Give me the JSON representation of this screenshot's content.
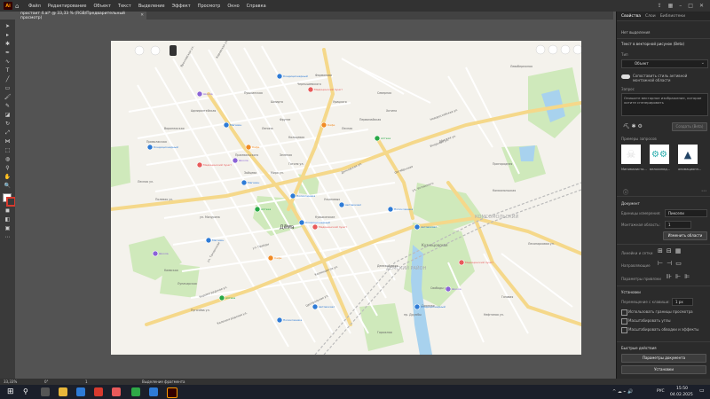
{
  "app": {
    "logo": "Ai"
  },
  "menu": [
    "Файл",
    "Редактирование",
    "Объект",
    "Текст",
    "Выделение",
    "Эффект",
    "Просмотр",
    "Окно",
    "Справка"
  ],
  "document_tab": {
    "title": "простоит 4.ai* @ 33,33 % (RGB/Предварительный просмотр)"
  },
  "map": {
    "labels": [
      "Ярославская ул.",
      "Кировская ул.",
      "Адмиралтейская",
      "Воронежская",
      "Приволжская",
      "Пушкинская",
      "Дятковская ул.",
      "Октябрьская",
      "Лесная ул.",
      "Полевая ул.",
      "Дёма",
      "Демский парк",
      "Кольцевая",
      "Инорсная ул.",
      "ул. Правды",
      "Космонавтов ул.",
      "Новороссийская ул.",
      "Центральная ул.",
      "ул. Ухтомского",
      "Ульяновых",
      "Мира ул.",
      "Гоголя ул.",
      "Зелёная",
      "Кувыкинские",
      "Дёмская ул.",
      "Кировоградская ул.",
      "Пугачёва ул.",
      "Киевская",
      "Луначарская",
      "Комсомольская",
      "Лесопарковая ул.",
      "Пригородная",
      "Северная",
      "Хотина",
      "Нефтяная ул.",
      "Газовая",
      "Ленина",
      "Фрунзе",
      "Шмидта",
      "Левобережная",
      "ул. Мичурина",
      "Калининградская ул.",
      "ул. Таллинская",
      "Чернышевского",
      "Фарманова",
      "Зайцева",
      "Пржевальского",
      "Лесная",
      "Первомайская",
      "Урицкого",
      "пр. Дружбы",
      "Гаражная",
      "Союзная",
      "Свободы ул."
    ],
    "pois": [
      {
        "name": "Кондиционерный",
        "color": "#2e7bd6"
      },
      {
        "name": "Медицинский пункт",
        "color": "#e85a5a"
      },
      {
        "name": "Школа",
        "color": "#8a62d6"
      },
      {
        "name": "Кафе",
        "color": "#f08a24"
      },
      {
        "name": "Магазин",
        "color": "#2e7bd6"
      },
      {
        "name": "Аптека",
        "color": "#27a846"
      },
      {
        "name": "Поликлиника",
        "color": "#2e7bd6"
      },
      {
        "name": "Автовокзал",
        "color": "#2e7bd6"
      }
    ],
    "district_labels": [
      "Дёма",
      "ДЁМСКИЙ РАЙОН",
      "Кузнецовская",
      "КОМСОМОЛЬСКИЙ"
    ]
  },
  "panel": {
    "tabs": [
      "Свойства",
      "Слои",
      "Библиотеки"
    ],
    "no_selection": "Нет выделения",
    "section_title": "Текст в векторной рисунок (Beta)",
    "prompt_label": "Тип",
    "prompt_value": "Объект",
    "toggle_label": "Сопоставить стиль активной монтажной области",
    "prompt_input_label": "Запрос",
    "prompt_placeholder": "Опишите векторное изображение, которое хотите сгенерировать",
    "generate_button": "Создать (Beta)",
    "samples_label": "Примеры запросов",
    "samples": [
      {
        "label": "Минималисти...",
        "icon": "skull-icon"
      },
      {
        "label": "велосипед...",
        "icon": "bicycle-icon"
      },
      {
        "label": "анимационн...",
        "icon": "rocket-icon"
      }
    ],
    "document_section": "Документ",
    "units_label": "Единицы измерения:",
    "units_value": "Пиксели",
    "artboard_label": "Монтажная область:",
    "artboard_value": "1",
    "edit_artboard_button": "Изменить области",
    "rulers_label": "Линейки и сетки",
    "guides_label": "Направляющие",
    "snap_label": "Параметры привязки",
    "prefs_section": "Установки",
    "nudge_label": "Перемещение с клавиши:",
    "nudge_value": "1 px",
    "check_preview_bounds": "Использовать границы просмотра",
    "check_scale_corners": "Масштабировать углы",
    "check_scale_strokes": "Масштабировать обводки и эффекты",
    "quick_actions": "Быстрые действия",
    "doc_setup_button": "Параметры документа",
    "prefs_button": "Установки"
  },
  "status": {
    "zoom": "33,33%",
    "angle": "0°",
    "artboard": "1",
    "tool": "Выделение фрагмента"
  },
  "taskbar": {
    "time": "15:50",
    "date": "04.02.2025",
    "lang": "РУС"
  },
  "colors": {
    "menubar": "#323232",
    "panel": "#2b2b2b",
    "road_major": "#f6d27a",
    "road_minor": "#ffffff",
    "park": "#bfe3a8",
    "water": "#9ecbe8"
  }
}
